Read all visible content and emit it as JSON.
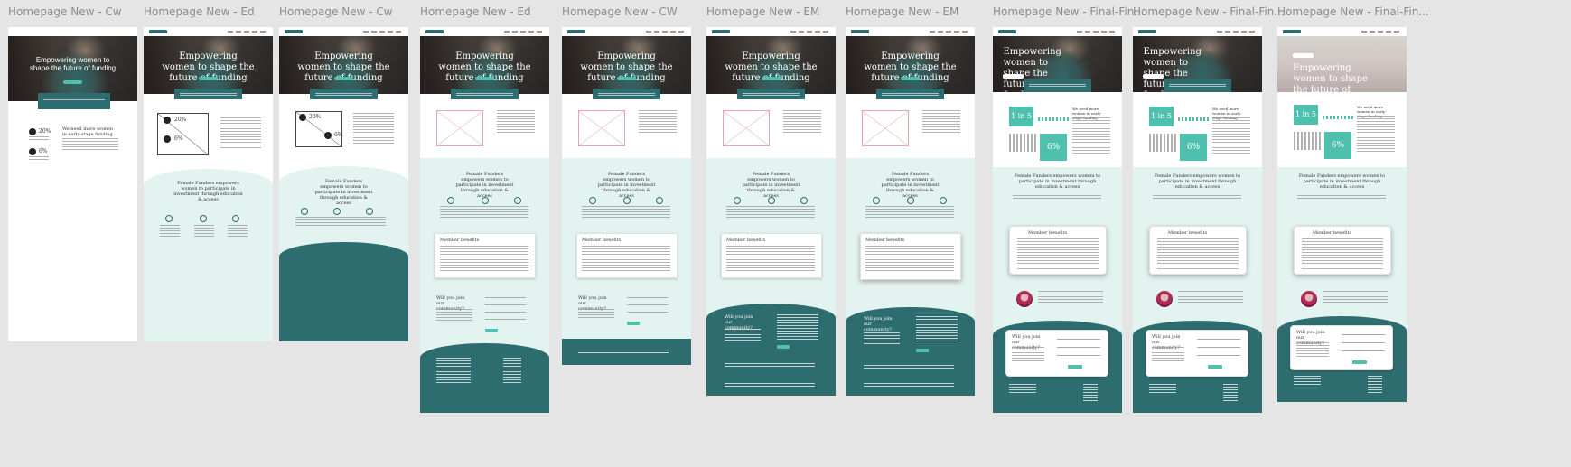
{
  "frames": [
    {
      "label": "Homepage New - Cw",
      "variant": "cw1",
      "hero_title": "Empowering women to shape the future of funding"
    },
    {
      "label": "Homepage New - Ed",
      "variant": "ed1",
      "hero_title": "Empowering women to shape the future of funding"
    },
    {
      "label": "Homepage New - Cw",
      "variant": "cw2",
      "hero_title": "Empowering women to shape the future of funding"
    },
    {
      "label": "Homepage New - Ed",
      "variant": "ed2",
      "hero_title": "Empowering women to shape the future of funding"
    },
    {
      "label": "Homepage New - CW",
      "variant": "cw3",
      "hero_title": "Empowering women to shape the future of funding"
    },
    {
      "label": "Homepage New - EM",
      "variant": "em1",
      "hero_title": "Empowering women to shape the future of funding"
    },
    {
      "label": "Homepage New - EM",
      "variant": "em2",
      "hero_title": "Empowering women to shape the future of funding"
    },
    {
      "label": "Homepage New - Final-Fin...",
      "variant": "fin1",
      "hero_title": "Empowering women to shape the future of funding."
    },
    {
      "label": "Homepage New - Final-Fin...",
      "variant": "fin2",
      "hero_title": "Empowering women to shape the future of funding."
    },
    {
      "label": "Homepage New - Final-Fin...",
      "variant": "fin3",
      "hero_title": "Empowering women to shape the future of funding."
    }
  ],
  "common": {
    "stat_1": "20%",
    "stat_2": "6%",
    "stat_big_1": "1 in 5",
    "stat_big_2": "6%",
    "section_heading": "Female Funders empowers women to participate in investment through education & access",
    "benefits_title": "Member benefits",
    "join_title": "Will you join our community?",
    "stats_heading": "We need more women in early-stage funding"
  },
  "colors": {
    "teal_dark": "#2e6d6f",
    "teal_accent": "#4fc0ad",
    "mint_bg": "#e3f3ef",
    "canvas": "#e5e5e5"
  }
}
